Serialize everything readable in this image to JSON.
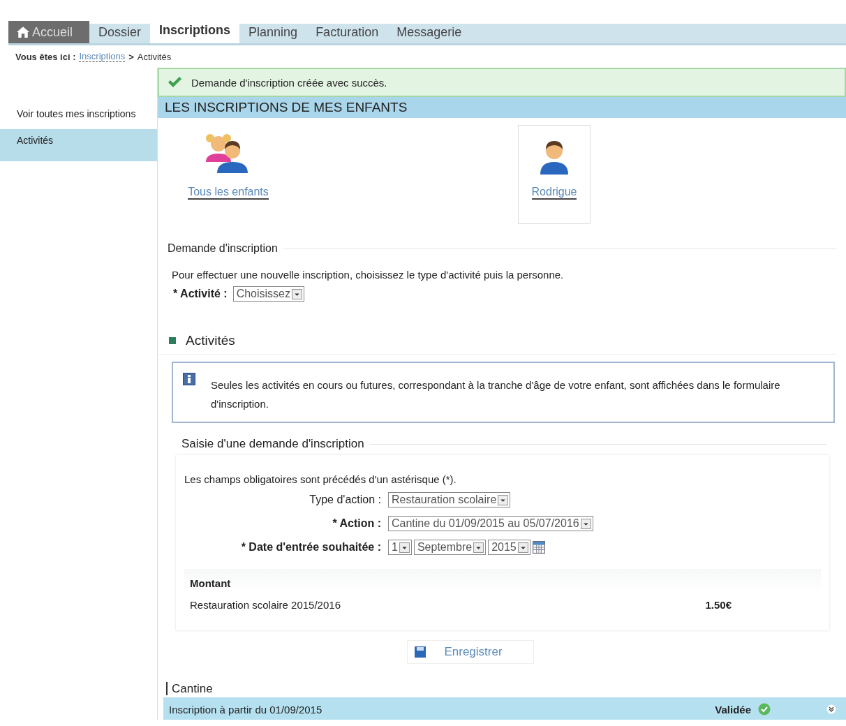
{
  "nav_tabs": [
    {
      "label": "Accueil",
      "kind": "home",
      "selected": false
    },
    {
      "label": "Dossier",
      "kind": "plain",
      "selected": false
    },
    {
      "label": "Inscriptions",
      "kind": "plain",
      "selected": true
    },
    {
      "label": "Planning",
      "kind": "plain",
      "selected": false
    },
    {
      "label": "Facturation",
      "kind": "plain",
      "selected": false
    },
    {
      "label": "Messagerie",
      "kind": "plain",
      "selected": false
    }
  ],
  "breadcrumb": {
    "label": "Vous êtes ici :",
    "link": "Inscriptions",
    "separator": ">",
    "current": "Activités"
  },
  "success_message": "Demande d'inscription créée avec succès.",
  "sidebar": {
    "items": [
      {
        "label": "Voir toutes mes inscriptions",
        "selected": false
      },
      {
        "label": "Activités",
        "selected": true
      }
    ]
  },
  "section_title": "LES INSCRIPTIONS DE MES ENFANTS",
  "children": [
    {
      "name": "Tous les enfants",
      "kind": "group",
      "selected": false
    },
    {
      "name": "Rodrigue",
      "kind": "single",
      "selected": true
    }
  ],
  "request": {
    "legend": "Demande d'inscription",
    "intro": "Pour effectuer une nouvelle inscription, choisissez le type d'activité puis la personne.",
    "activity_label": "* Activité :",
    "activity_value": "Choisissez"
  },
  "activities": {
    "title": "Activités",
    "info": "Seules les activités en cours ou futures, correspondant à la tranche d'âge de votre enfant, sont affichées dans le formulaire d'inscription.",
    "form": {
      "legend": "Saisie d'une demande d'inscription",
      "note": "Les champs obligatoires sont précédés d'un astérisque (*).",
      "fields": [
        {
          "label": "Type d'action :",
          "values": [
            "Restauration scolaire"
          ]
        },
        {
          "label": "* Action :",
          "values": [
            "Cantine du 01/09/2015 au 05/07/2016"
          ]
        },
        {
          "label": "* Date d'entrée souhaitée :",
          "values": [
            "1",
            "Septembre",
            "2015"
          ]
        }
      ],
      "amount": {
        "title": "Montant",
        "item": "Restauration scolaire 2015/2016",
        "price": "1.50€"
      }
    },
    "save_button": "Enregistrer"
  },
  "registrations": {
    "title": "Cantine",
    "rows": [
      {
        "label": "Inscription à partir du 01/09/2015",
        "status": "Validée"
      }
    ]
  }
}
